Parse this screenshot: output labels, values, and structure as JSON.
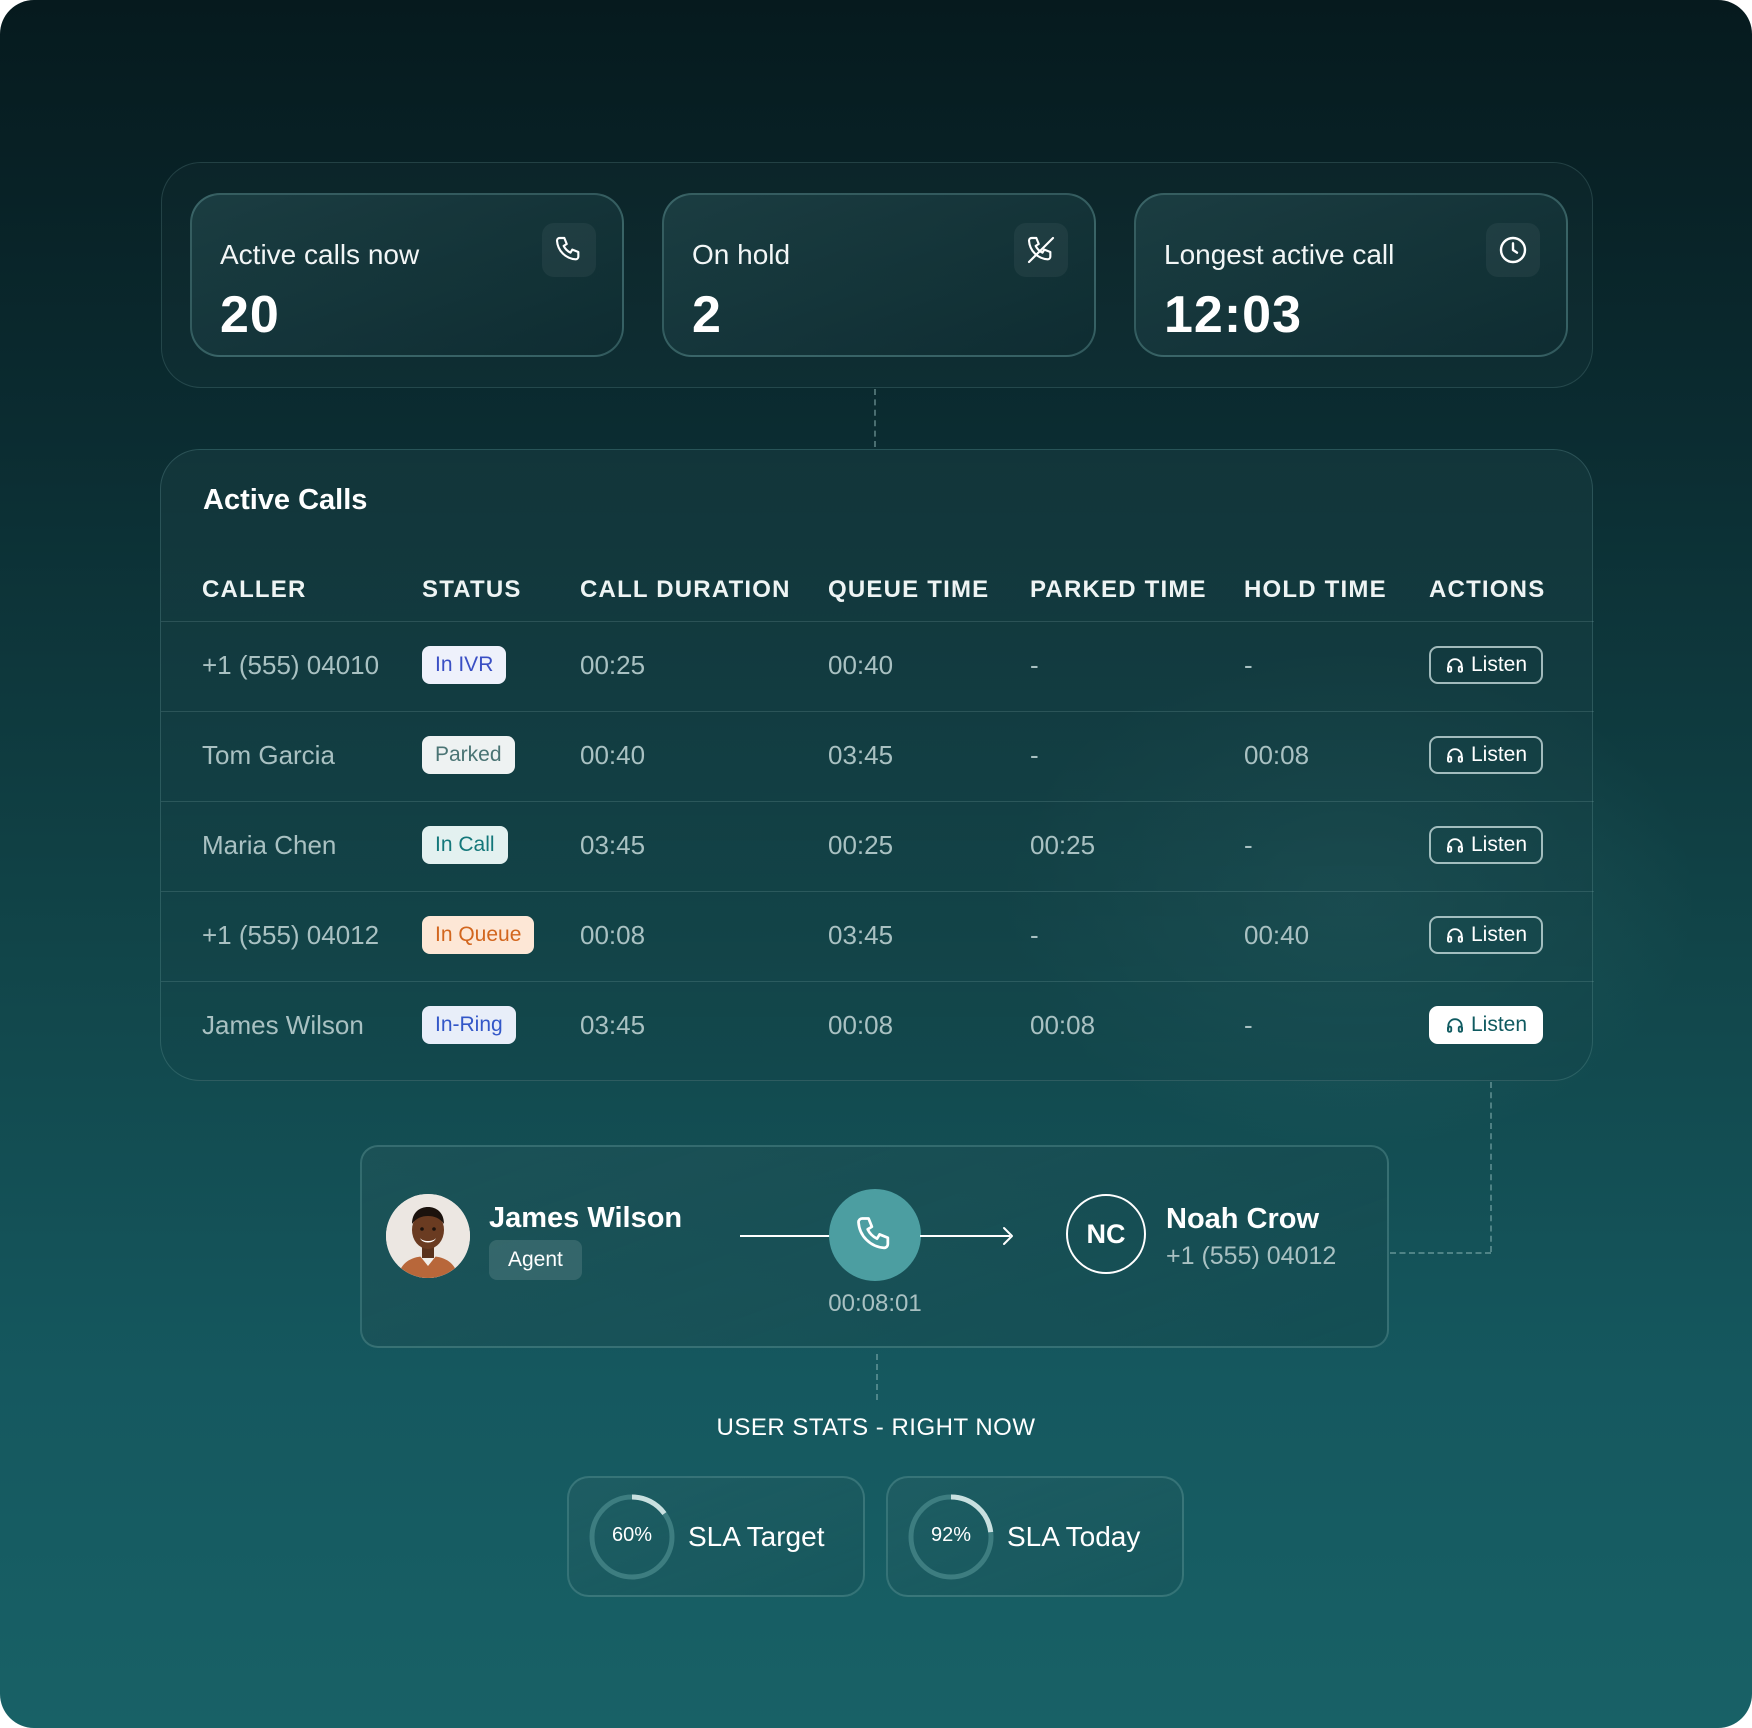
{
  "stats": [
    {
      "label": "Active calls now",
      "value": "20",
      "icon": "phone-icon"
    },
    {
      "label": "On hold",
      "value": "2",
      "icon": "phone-off-icon"
    },
    {
      "label": "Longest active call",
      "value": "12:03",
      "icon": "clock-icon"
    }
  ],
  "table": {
    "title": "Active Calls",
    "columns": [
      "CALLER",
      "STATUS",
      "CALL DURATION",
      "QUEUE TIME",
      "PARKED TIME",
      "HOLD TIME",
      "ACTIONS"
    ],
    "rows": [
      {
        "caller": "+1 (555) 04010",
        "status": "In IVR",
        "duration": "00:25",
        "queue": "00:40",
        "parked": "-",
        "hold": "-",
        "action": "Listen"
      },
      {
        "caller": "Tom Garcia",
        "status": "Parked",
        "duration": "00:40",
        "queue": "03:45",
        "parked": "-",
        "hold": "00:08",
        "action": "Listen"
      },
      {
        "caller": "Maria Chen",
        "status": "In Call",
        "duration": "03:45",
        "queue": "00:25",
        "parked": "00:25",
        "hold": "-",
        "action": "Listen"
      },
      {
        "caller": "+1 (555) 04012",
        "status": "In Queue",
        "duration": "00:08",
        "queue": "03:45",
        "parked": "-",
        "hold": "00:40",
        "action": "Listen"
      },
      {
        "caller": "James Wilson",
        "status": "In-Ring",
        "duration": "03:45",
        "queue": "00:08",
        "parked": "00:08",
        "hold": "-",
        "action": "Listen"
      }
    ],
    "status_colors": {
      "In IVR": {
        "bg": "#eef1fb",
        "fg": "#3a4fc4"
      },
      "Parked": {
        "bg": "#eef2f2",
        "fg": "#4a7474"
      },
      "In Call": {
        "bg": "#e3f1f0",
        "fg": "#13777a"
      },
      "In Queue": {
        "bg": "#fde7d6",
        "fg": "#d2661e"
      },
      "In-Ring": {
        "bg": "#e8eef9",
        "fg": "#3357c8"
      }
    }
  },
  "call": {
    "agent_name": "James Wilson",
    "agent_role": "Agent",
    "duration": "00:08:01",
    "callee_initials": "NC",
    "callee_name": "Noah Crow",
    "callee_phone": "+1 (555) 04012"
  },
  "user_stats": {
    "title": "USER STATS - RIGHT NOW",
    "items": [
      {
        "label": "SLA Target",
        "percent_text": "60%",
        "value": 0.6
      },
      {
        "label": "SLA Today",
        "percent_text": "92%",
        "value": 0.92
      }
    ]
  },
  "colors": {
    "accent": "#4c9ea1",
    "ring_track": "#3d7d80",
    "ring_fill": "#c9e0e0"
  }
}
